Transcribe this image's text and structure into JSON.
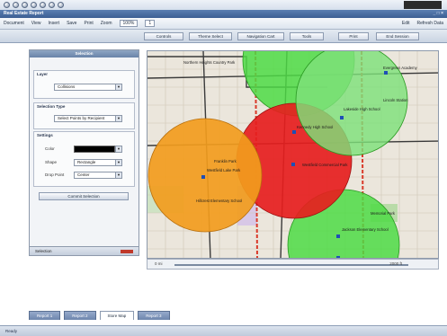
{
  "window": {
    "title": "Real Estate Report",
    "controls": "_ □ ×"
  },
  "menubar": {
    "items": [
      "Document",
      "View",
      "Insert",
      "Save",
      "Print"
    ],
    "zoom_label": "Zoom",
    "zoom_value": "100%",
    "page_value": "1",
    "right_items": [
      "Edit",
      "Refresh Data"
    ]
  },
  "ribbon": {
    "buttons": [
      "Controls",
      "Theme Select",
      "Navigation Cart",
      "Tools",
      "Print",
      "End Session"
    ]
  },
  "selection_panel": {
    "title": "Selection",
    "layer_label": "Layer",
    "layer_value": "Collisions",
    "selection_type_label": "Selection Type",
    "selection_type_value": "Select Points by Recipient",
    "settings_label": "Settings",
    "color_label": "Color",
    "color_value": "#000000",
    "shape_label": "Shape",
    "shape_value": "Rectangle",
    "drop_point_label": "Drop Point",
    "drop_point_value": "Center",
    "commit_label": "Commit Selection",
    "footer_label": "Selection"
  },
  "map": {
    "labels": [
      "Northern Heights Country Park",
      "Lakeside High School",
      "Westfield Lake Park",
      "Westfield Commercial Park",
      "Hillcrest Elementary School",
      "Franklin Park",
      "Kennedy High School",
      "Jackson Elementary School",
      "Lincoln Station",
      "Evergreen Academy",
      "Memorial Park"
    ],
    "colors": {
      "orange": "#f29c1d",
      "red": "#e61e1e",
      "green": "#4edb45",
      "water": "#b9d3ee",
      "park": "#b9dba8"
    }
  },
  "scalebar": {
    "left_label": "0 mi",
    "right_label": "2000 ft"
  },
  "tabs": [
    "Report 1",
    "Report 2",
    "Store Map",
    "Report 3"
  ],
  "active_tab": "Store Map",
  "status": {
    "text": "Ready"
  }
}
